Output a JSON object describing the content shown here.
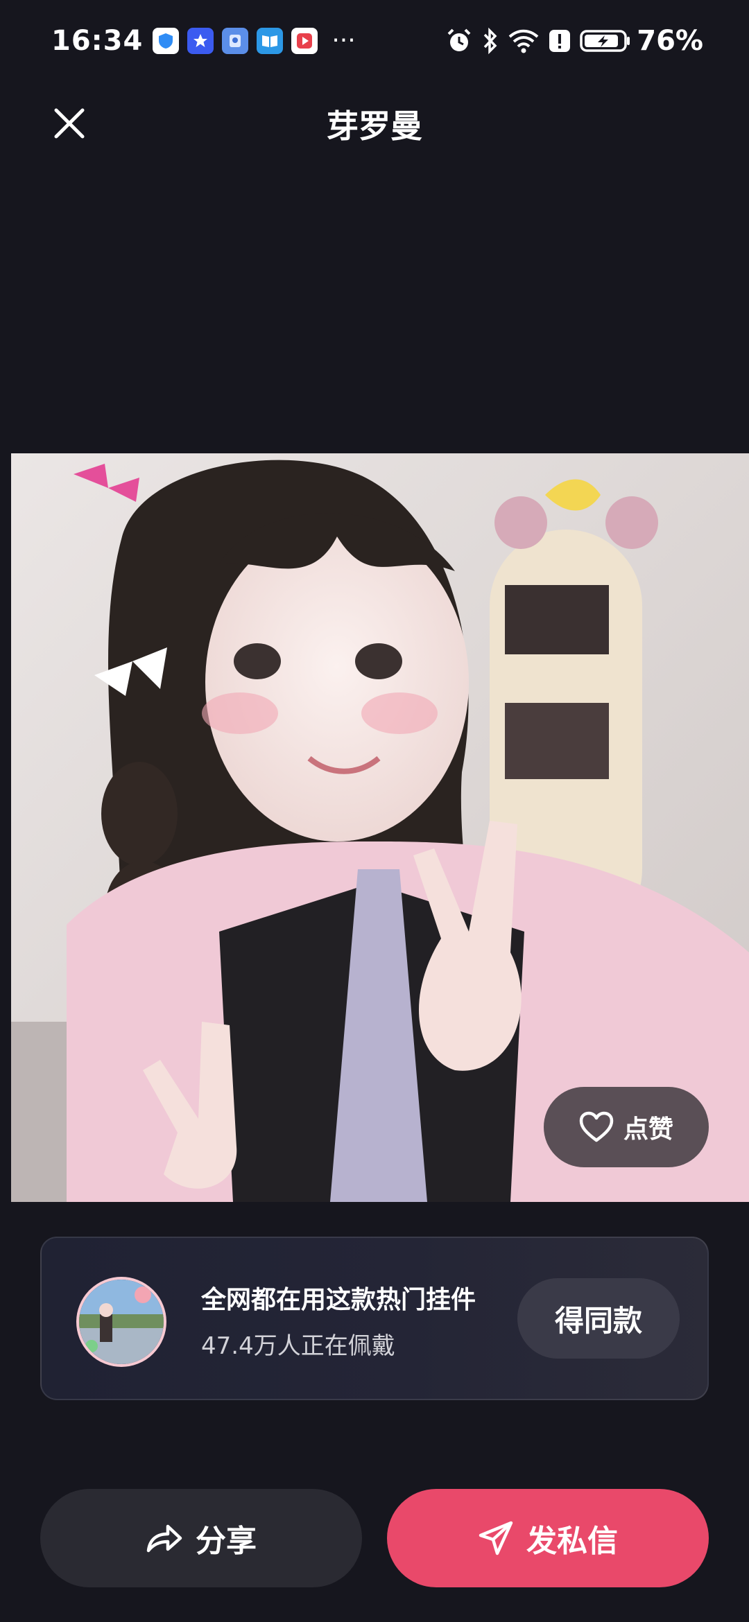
{
  "status_bar": {
    "time": "16:34",
    "battery": "76%",
    "more": "···",
    "app_icons": [
      "shield-app",
      "star-app",
      "tile-app",
      "book-app",
      "video-app"
    ],
    "right_icons": [
      "alarm-icon",
      "bluetooth-icon",
      "wifi-icon",
      "alert-icon",
      "battery-icon"
    ]
  },
  "header": {
    "title": "芽罗曼",
    "close_icon": "close-icon"
  },
  "photo": {
    "like_label": "点赞"
  },
  "promo": {
    "title": "全网都在用这款热门挂件",
    "subtitle": "47.4万人正在佩戴",
    "button_label": "得同款"
  },
  "actions": {
    "share_label": "分享",
    "message_label": "发私信"
  },
  "colors": {
    "background": "#16161e",
    "accent": "#e9496a",
    "card": "#232434"
  }
}
